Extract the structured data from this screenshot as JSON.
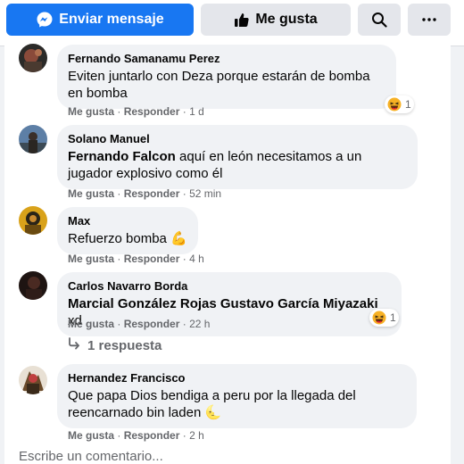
{
  "actions": {
    "message_label": "Enviar mensaje",
    "like_label": "Me gusta"
  },
  "icons": {
    "messenger": "messenger-icon",
    "thumbs_up": "thumbs-up-icon",
    "search": "search-icon",
    "more": "more-icon",
    "haha": "haha-reaction-icon",
    "reply_arrow": "reply-arrow-icon"
  },
  "colors": {
    "primary": "#1877f2",
    "secondary_btn": "#e4e6eb",
    "bubble": "#f0f2f5",
    "muted_text": "#65676b"
  },
  "comments": [
    {
      "author": "Fernando Samanamu Perez",
      "text": "Eviten juntarlo con Deza porque estarán de bomba en bomba",
      "like": "Me gusta",
      "reply": "Responder",
      "time": "1 d",
      "reaction_count": "1"
    },
    {
      "author": "Solano Manuel",
      "mention": "Fernando Falcon",
      "text": "aquí en león necesitamos a un jugador explosivo como él",
      "like": "Me gusta",
      "reply": "Responder",
      "time": "52 min"
    },
    {
      "author": "Max",
      "text": "Refuerzo bomba",
      "emoji": "💪",
      "like": "Me gusta",
      "reply": "Responder",
      "time": "4 h"
    },
    {
      "author": "Carlos Navarro Borda",
      "mention": "Marcial González Rojas Gustavo García Miyazaki",
      "text": "xd",
      "like": "Me gusta",
      "reply": "Responder",
      "time": "22 h",
      "reaction_count": "1",
      "replies_label": "1 respuesta"
    },
    {
      "author": "Hernandez Francisco",
      "text": "Que papa Dios bendiga a peru por la llegada del reencarnado bin laden",
      "emoji": "🌜",
      "like": "Me gusta",
      "reply": "Responder",
      "time": "2 h"
    }
  ],
  "composer": {
    "placeholder": "Escribe un comentario..."
  }
}
